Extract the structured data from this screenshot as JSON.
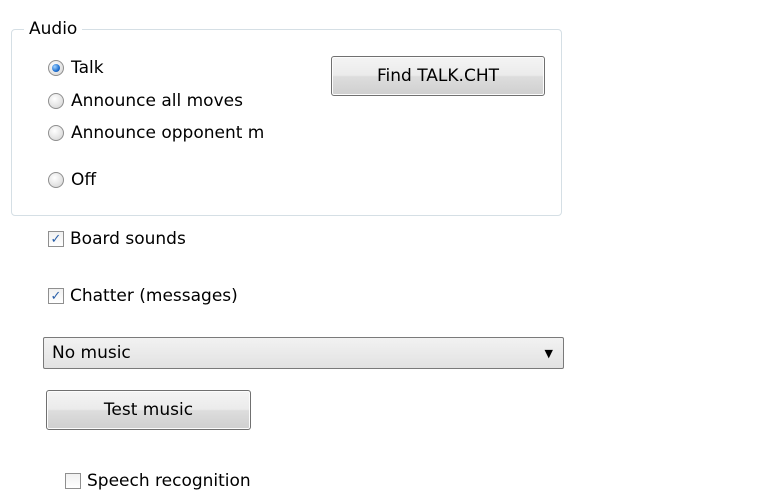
{
  "audio_group": {
    "title": "Audio",
    "radios": [
      {
        "label": "Talk",
        "checked": true
      },
      {
        "label": "Announce all moves",
        "checked": false
      },
      {
        "label": "Announce opponent moves",
        "checked": false
      },
      {
        "label": "Off",
        "checked": false
      }
    ],
    "find_button_label": "Find TALK.CHT"
  },
  "board_sounds": {
    "label": "Board sounds",
    "checked": true
  },
  "chatter": {
    "label": "Chatter (messages)",
    "checked": true
  },
  "music_select": {
    "value": "No music"
  },
  "test_music_button_label": "Test music",
  "speech_recognition": {
    "label": "Speech recognition",
    "checked": false
  }
}
